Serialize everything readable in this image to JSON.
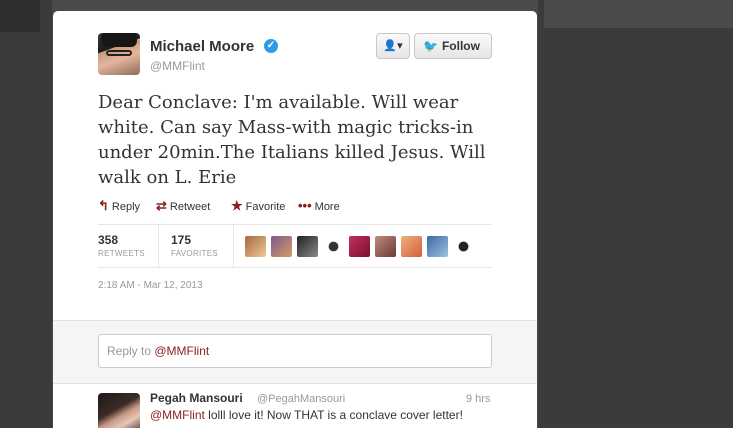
{
  "tweet": {
    "author_name": "Michael Moore",
    "author_handle": "@MMFlint",
    "text": "Dear Conclave: I'm available. Will wear white. Can say Mass-with magic tricks-in under 20min.The Italians killed Jesus. Will walk on L. Erie",
    "timestamp": "2:18 AM - Mar 12, 2013"
  },
  "header_buttons": {
    "user_menu_icon": "person-icon",
    "follow_label": "Follow"
  },
  "actions": {
    "reply": "Reply",
    "retweet": "Retweet",
    "favorite": "Favorite",
    "more": "More"
  },
  "stats": {
    "retweets_count": "358",
    "retweets_label": "RETWEETS",
    "favorites_count": "175",
    "favorites_label": "FAVORITES"
  },
  "reply_box": {
    "prefix": "Reply to ",
    "mention": "@MMFlint"
  },
  "reply": {
    "name": "Pegah Mansouri",
    "handle": "@PegahMansouri",
    "time": "9 hrs",
    "mention": "@MMFlint",
    "text": " lolll love it! Now THAT is a conclave cover letter!"
  },
  "colors": {
    "link": "#8a1d1d",
    "verified": "#2e9be6",
    "twitter_blue": "#2aa3ef"
  }
}
